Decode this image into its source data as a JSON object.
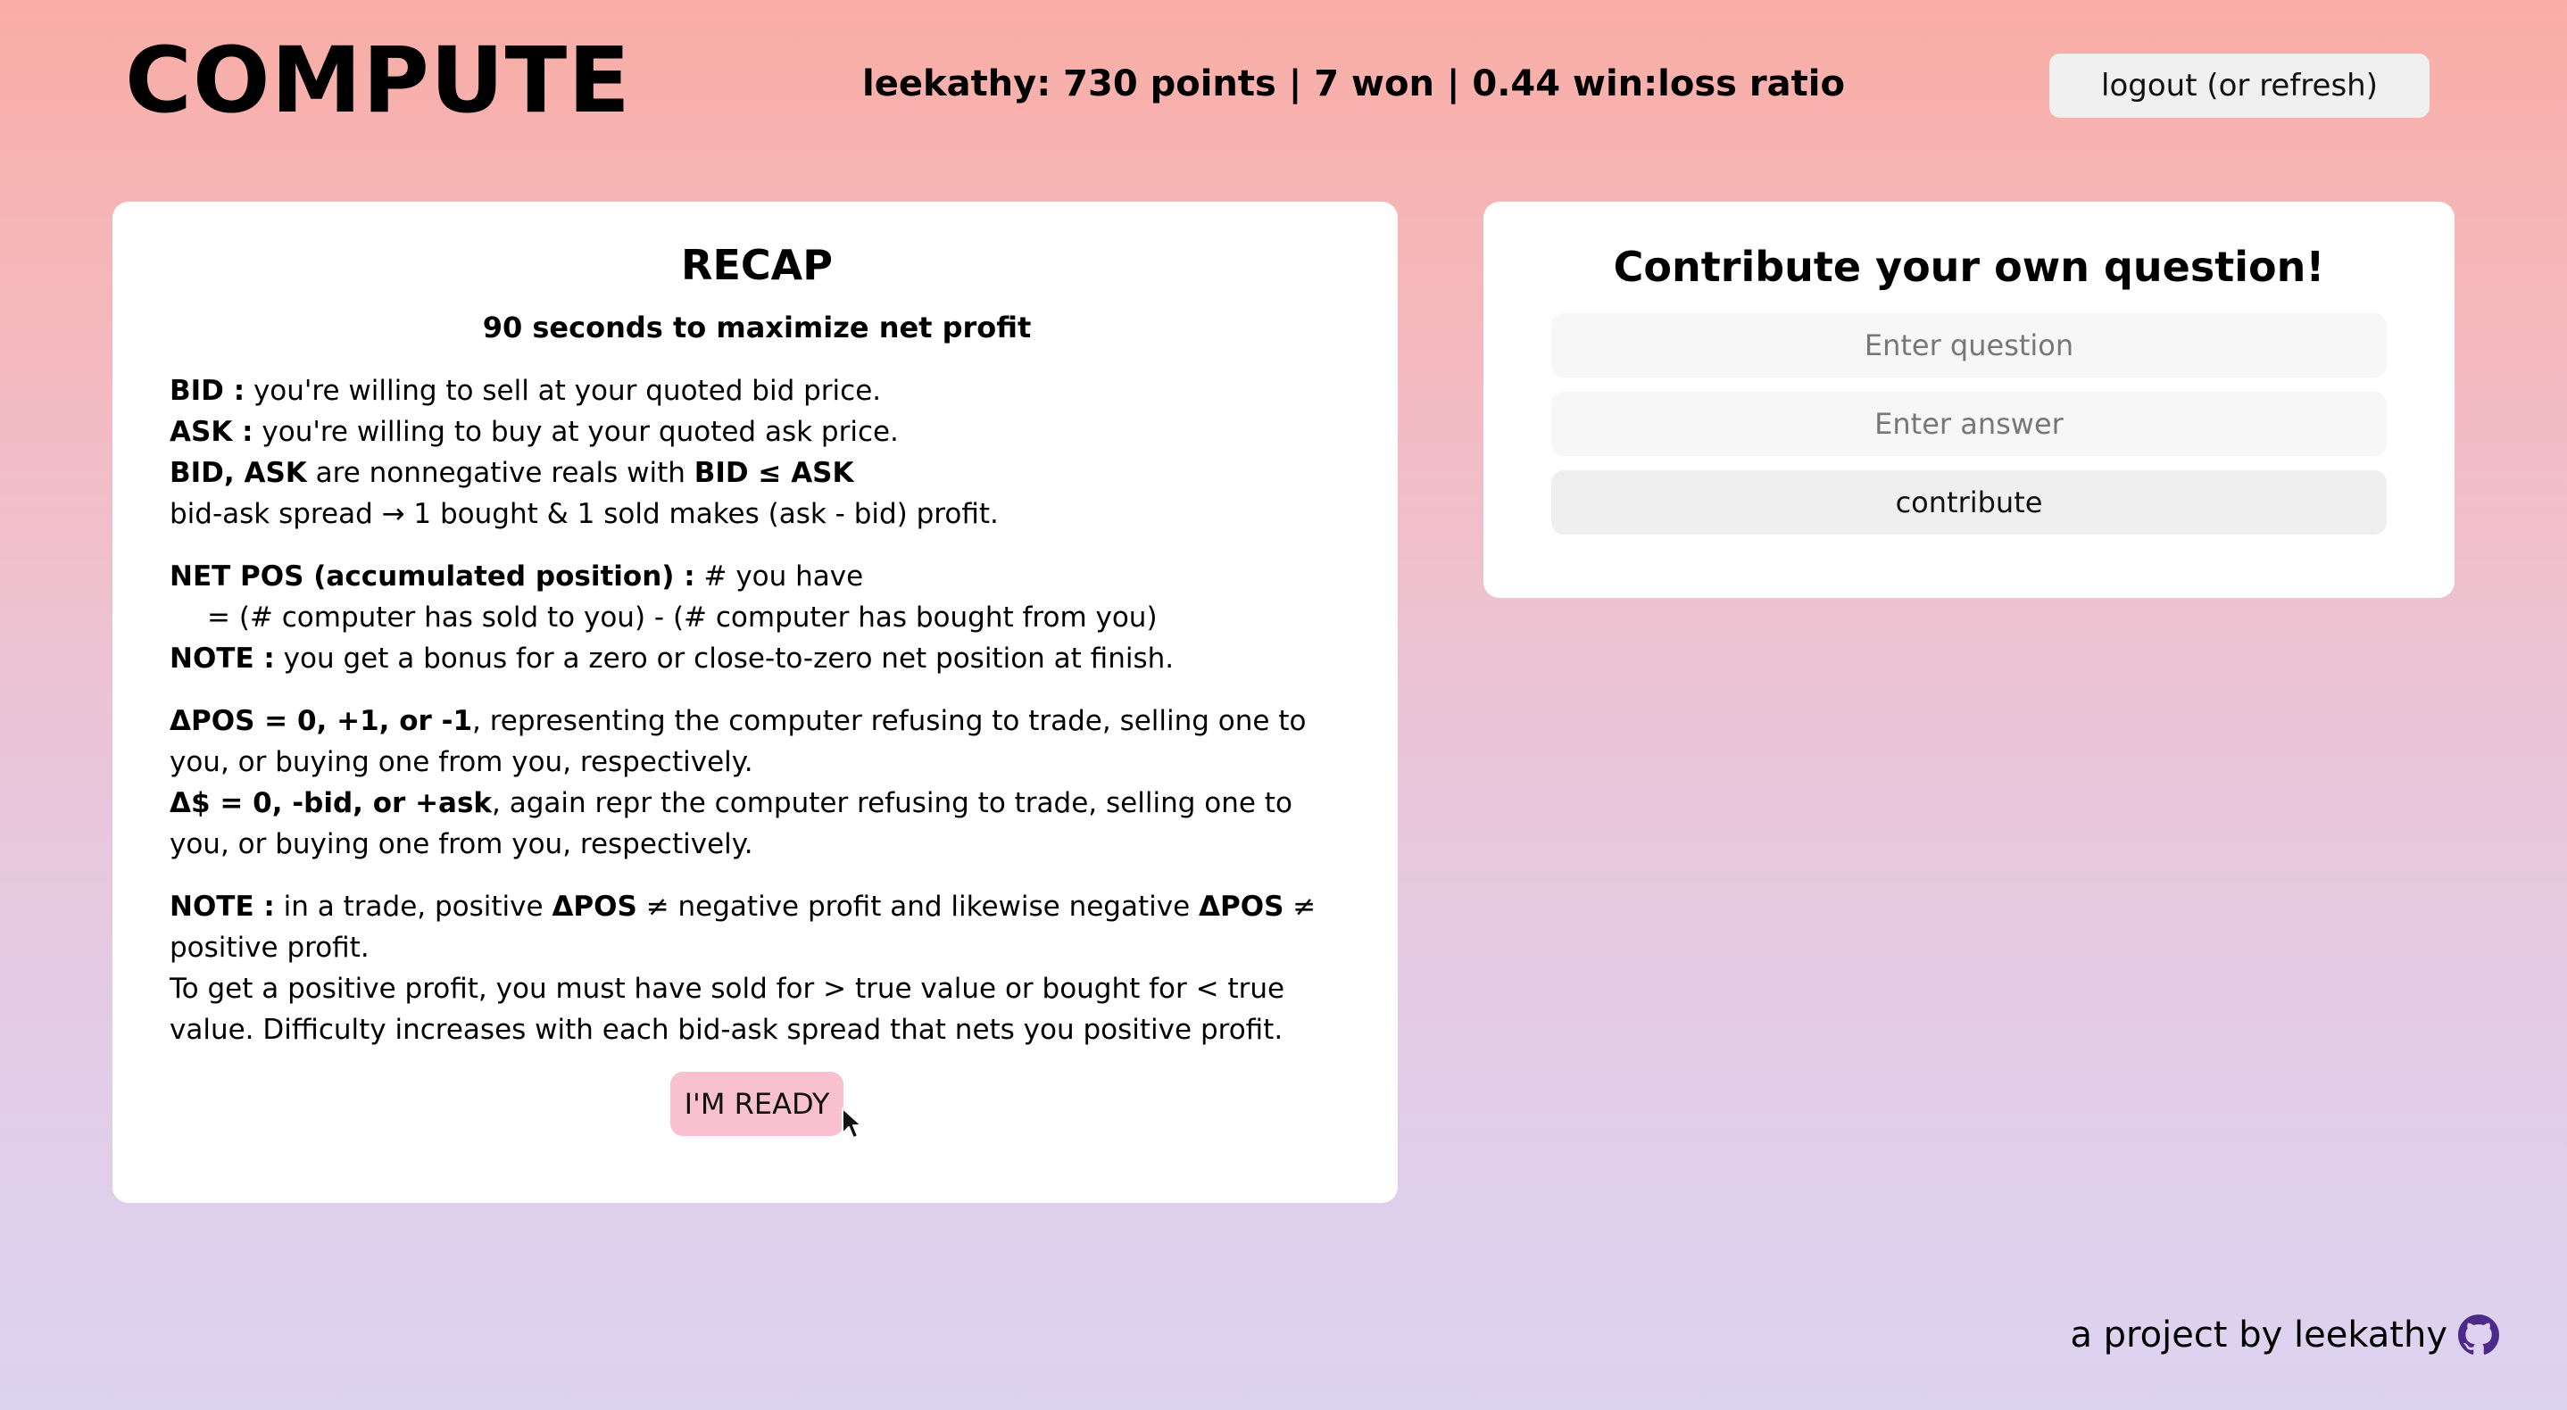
{
  "header": {
    "logo": "COMPUTE",
    "stats": "leekathy: 730 points | 7 won | 0.44 win:loss ratio",
    "logout_label": "logout (or refresh)"
  },
  "recap": {
    "title": "RECAP",
    "subtitle": "90 seconds to maximize net profit",
    "p1": {
      "bid_label": "BID :",
      "bid_text": " you're willing to sell at your quoted bid price.",
      "ask_label": "ASK :",
      "ask_text": " you're willing to buy at your quoted ask price.",
      "bidask_label": "BID, ASK",
      "bidask_text": " are nonnegative reals with ",
      "bidask_rel": "BID ≤ ASK",
      "spread_text": "bid-ask spread → 1 bought & 1 sold makes (ask - bid) profit."
    },
    "p2": {
      "netpos_label": "NET POS (accumulated position) :",
      "netpos_text": " # you have",
      "netpos_formula": "= (# computer has sold to you) - (# computer has bought from you)",
      "note_label": "NOTE :",
      "note_text": " you get a bonus for a zero or close-to-zero net position at finish."
    },
    "p3": {
      "dpos_label": "ΔPOS = 0, +1, or -1",
      "dpos_text": ", representing the computer refusing to trade, selling one to you, or buying one from you, respectively.",
      "dcash_label": "Δ$ = 0, -bid, or +ask",
      "dcash_text": ", again repr the computer refusing to trade, selling one to you, or buying one from you, respectively."
    },
    "p4": {
      "note_label": "NOTE :",
      "text_a": " in a trade, positive ",
      "dpos1": "ΔPOS",
      "text_b": " ≠ negative profit and likewise negative ",
      "dpos2": "ΔPOS",
      "text_c": " ≠ positive profit.",
      "final": "To get a positive profit, you must have sold for > true value or bought for < true value. Difficulty increases with each bid-ask spread that nets you positive profit."
    },
    "ready_label": "I'M READY"
  },
  "contribute": {
    "title": "Contribute your own question!",
    "question_placeholder": "Enter question",
    "answer_placeholder": "Enter answer",
    "button_label": "contribute"
  },
  "footer": {
    "text": "a project by leekathy",
    "icon": "github-icon",
    "icon_color": "#4b2a8a"
  },
  "colors": {
    "ready_button": "#f9c0d0",
    "gradient_top": "#f9ada6",
    "gradient_bottom": "#dcd3f1"
  }
}
